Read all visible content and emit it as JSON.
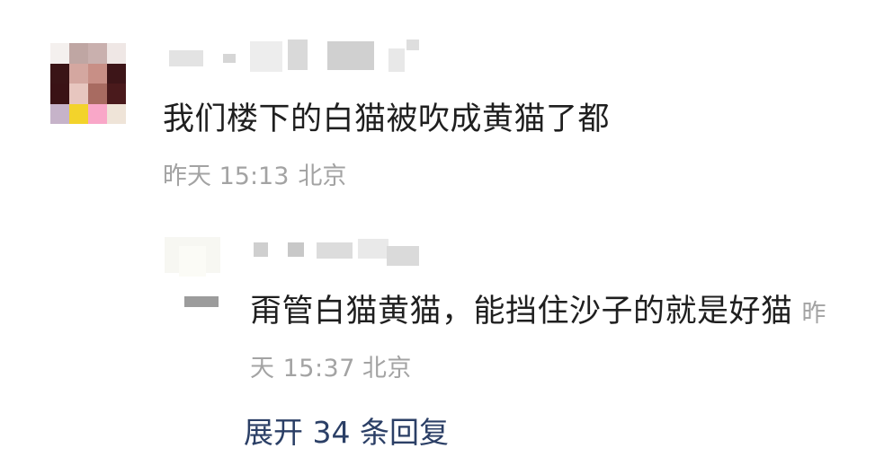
{
  "comment": {
    "text": "我们楼下的白猫被吹成黄猫了都",
    "time": "昨天 15:13",
    "location": "北京",
    "avatar_colors": [
      "#f4f0ee",
      "#bfa6a3",
      "#c9b0ae",
      "#efe7e5",
      "#3a1416",
      "#d4a7a0",
      "#c88f86",
      "#3d1518",
      "#3a1215",
      "#e7c6bf",
      "#a86b61",
      "#4a1a1c",
      "#c6b3c9",
      "#f3d32b",
      "#f9a7c8",
      "#efe4d8"
    ]
  },
  "reply": {
    "text_main": "甭管白猫黄猫，能挡住沙子的就是好猫",
    "time": "昨天 15:37",
    "location": "北京"
  },
  "expand": {
    "label": "展开 34 条回复"
  }
}
